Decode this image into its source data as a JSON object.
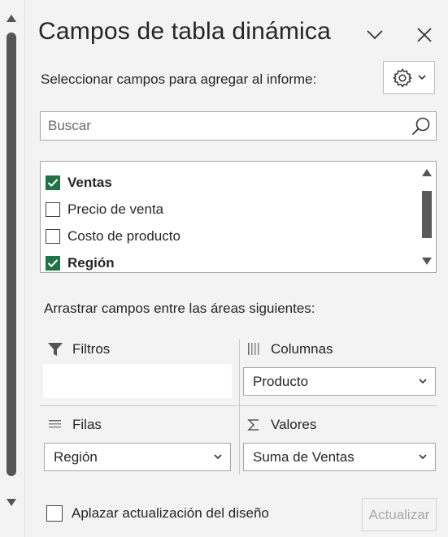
{
  "panel": {
    "title": "Campos de tabla dinámica",
    "subtitle": "Seleccionar campos para agregar al informe:"
  },
  "search": {
    "placeholder": "Buscar"
  },
  "fields": [
    {
      "label": "Ventas",
      "checked": true
    },
    {
      "label": "Precio de venta",
      "checked": false
    },
    {
      "label": "Costo de producto",
      "checked": false
    },
    {
      "label": "Región",
      "checked": true
    }
  ],
  "areas": {
    "instruction": "Arrastrar campos entre las áreas siguientes:",
    "filters": {
      "label": "Filtros"
    },
    "columns": {
      "label": "Columnas",
      "value": "Producto"
    },
    "rows": {
      "label": "Filas",
      "value": "Región"
    },
    "values": {
      "label": "Valores",
      "value": "Suma de Ventas"
    }
  },
  "footer": {
    "defer_label": "Aplazar actualización del diseño",
    "defer_checked": false,
    "update_label": "Actualizar"
  },
  "colors": {
    "checked": "#217346",
    "disabled_text": "#a9a9a9"
  }
}
